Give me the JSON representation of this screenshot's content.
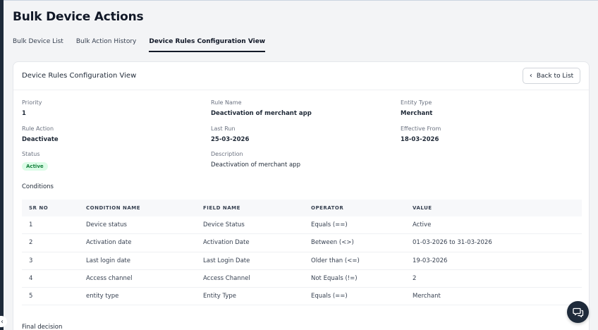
{
  "page": {
    "title": "Bulk Device Actions"
  },
  "tabs": [
    {
      "label": "Bulk Device List"
    },
    {
      "label": "Bulk Action History"
    },
    {
      "label": "Device Rules Configuration View"
    }
  ],
  "card": {
    "title": "Device Rules Configuration View",
    "back_label": "Back to List"
  },
  "details": {
    "priority": {
      "label": "Priority",
      "value": "1"
    },
    "rule_name": {
      "label": "Rule Name",
      "value": "Deactivation of merchant app"
    },
    "entity_type": {
      "label": "Entity Type",
      "value": "Merchant"
    },
    "rule_action": {
      "label": "Rule Action",
      "value": "Deactivate"
    },
    "last_run": {
      "label": "Last Run",
      "value": "25-03-2026"
    },
    "effective_from": {
      "label": "Effective From",
      "value": "18-03-2026"
    },
    "status": {
      "label": "Status",
      "value": "Active"
    },
    "description": {
      "label": "Description",
      "value": "Deactivation of merchant app"
    }
  },
  "conditions": {
    "label": "Conditions",
    "headers": [
      "SR NO",
      "CONDITION NAME",
      "FIELD NAME",
      "OPERATOR",
      "VALUE"
    ],
    "rows": [
      [
        "1",
        "Device status",
        "Device Status",
        "Equals (==)",
        "Active"
      ],
      [
        "2",
        "Activation date",
        "Activation Date",
        "Between (<>)",
        "01-03-2026 to 31-03-2026"
      ],
      [
        "3",
        "Last login date",
        "Last Login Date",
        "Older than (<=)",
        "19-03-2026"
      ],
      [
        "4",
        "Access channel",
        "Access Channel",
        "Not Equals (!=)",
        "2"
      ],
      [
        "5",
        "entity type",
        "Entity Type",
        "Equals (==)",
        "Merchant"
      ]
    ]
  },
  "final_decision": {
    "label": "Final decision"
  },
  "icons": {
    "back": "chevron-left-icon",
    "chat": "chat-support-icon",
    "collapse": "chevron-left-icon"
  },
  "colors": {
    "active_badge_bg": "#dcfce7",
    "active_badge_text": "#15803d",
    "fab_bg": "#1e2a3a"
  }
}
